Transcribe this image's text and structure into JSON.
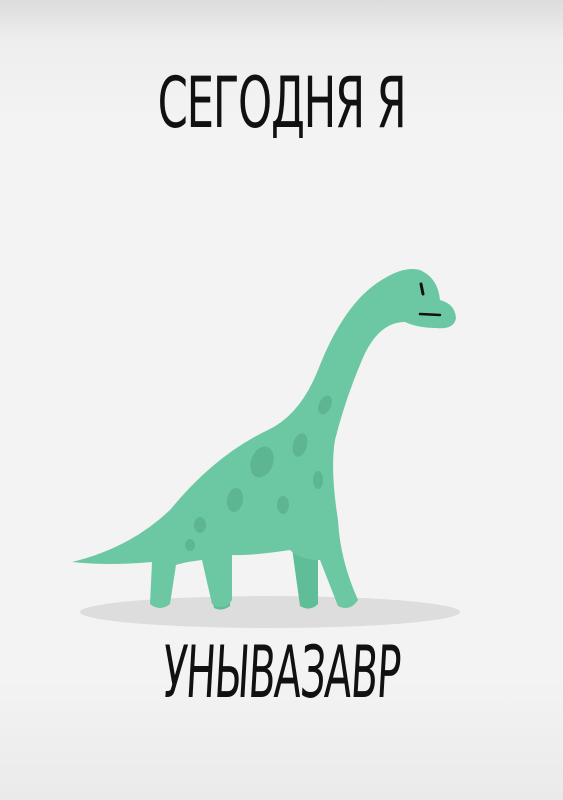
{
  "texts": {
    "top": "СЕГОДНЯ Я",
    "bottom": "УНЫВАЗАВР"
  },
  "illustration": {
    "subject": "brachiosaurus-dinosaur",
    "body_color": "#6cc8a3",
    "spot_color": "#5db592",
    "shadow_color": "#dcdcdc"
  }
}
